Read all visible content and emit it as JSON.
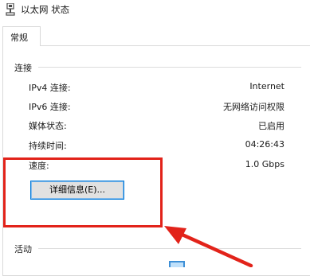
{
  "titlebar": {
    "title": "以太网 状态",
    "icon": "network-adapter-icon"
  },
  "tabs": [
    {
      "label": "常规",
      "selected": true
    }
  ],
  "connection": {
    "section_title": "连接",
    "rows": [
      {
        "label": "IPv4 连接:",
        "value": "Internet"
      },
      {
        "label": "IPv6 连接:",
        "value": "无网络访问权限"
      },
      {
        "label": "媒体状态:",
        "value": "已启用"
      },
      {
        "label": "持续时间:",
        "value": "04:26:43"
      },
      {
        "label": "速度:",
        "value": "1.0 Gbps"
      }
    ],
    "details_button": "详细信息(E)..."
  },
  "activity": {
    "section_title": "活动"
  },
  "annotation": {
    "color": "#e2231a"
  }
}
